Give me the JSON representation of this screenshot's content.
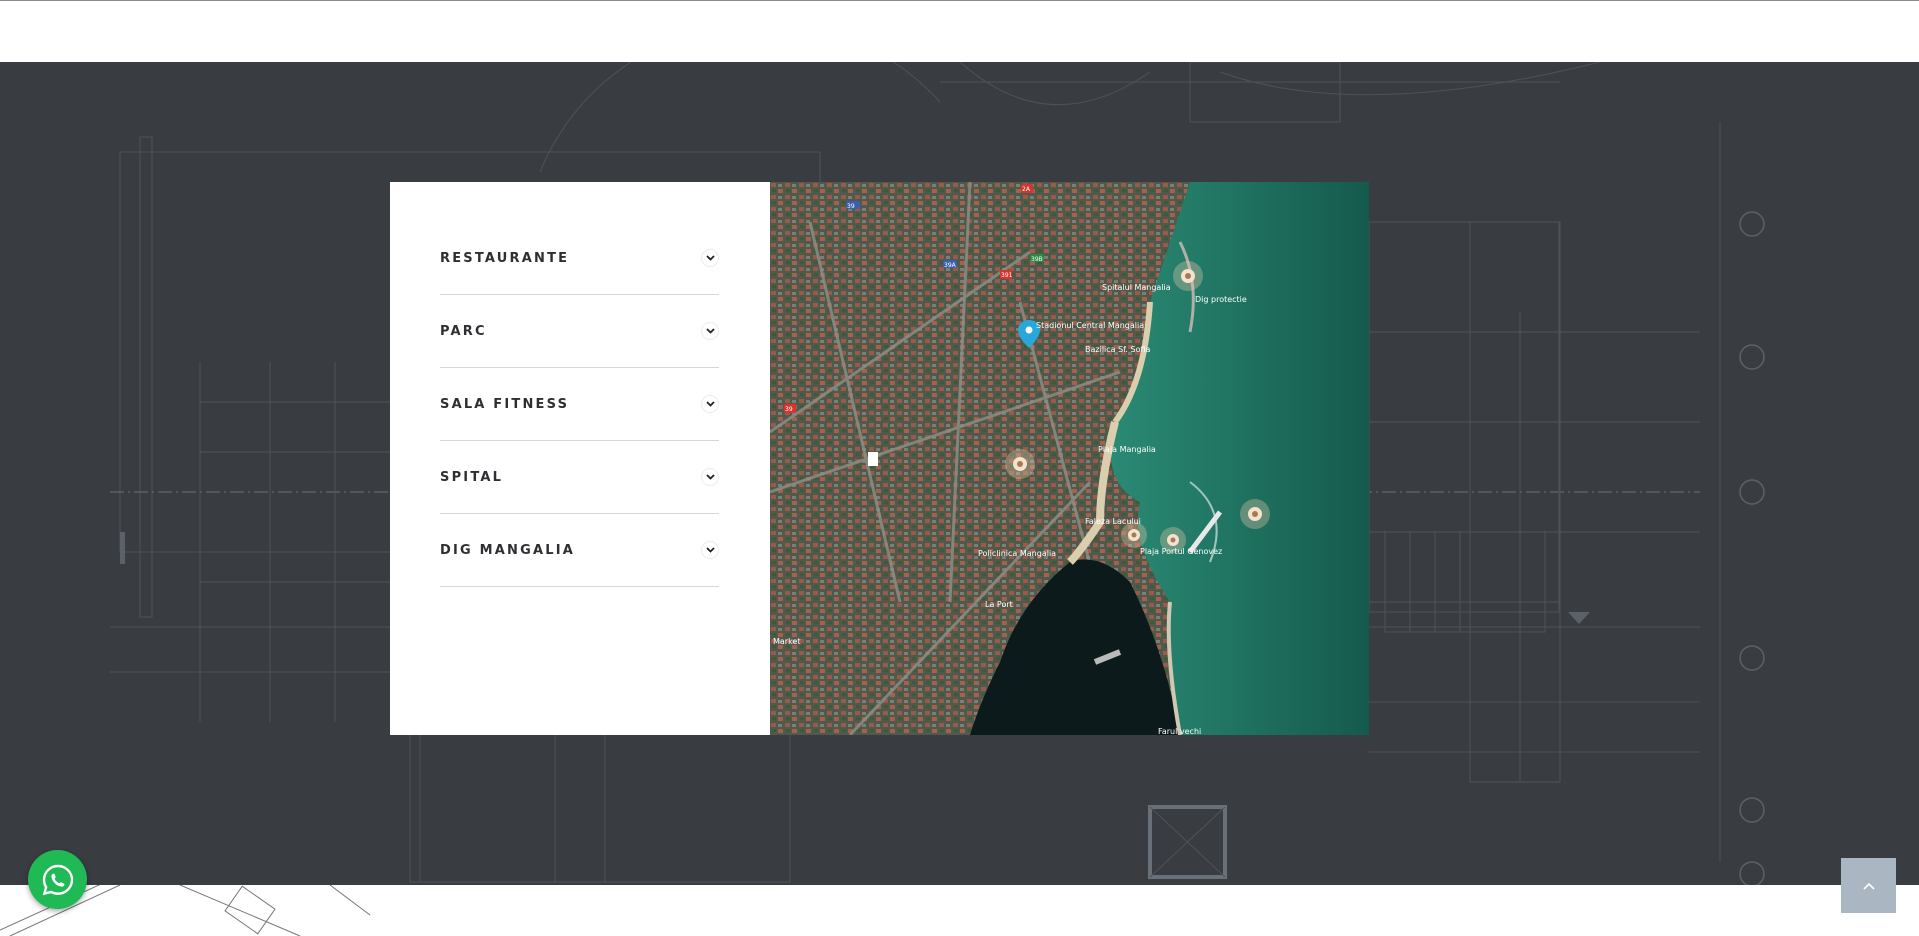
{
  "accordion": {
    "items": [
      {
        "label": "RESTAURANTE"
      },
      {
        "label": "PARC"
      },
      {
        "label": "SALA FITNESS"
      },
      {
        "label": "SPITAL"
      },
      {
        "label": "DIG MANGALIA"
      }
    ]
  },
  "map": {
    "labels": {
      "spital": "Spitalul Mangalia",
      "dig": "Dig protectie",
      "stadion": "Stadionul Central Mangalia",
      "bazilica": "Bazilica Sf. Sofia",
      "plaja": "Plaja Mangalia",
      "faleza": "Faleza Lacului",
      "portul": "Plaja Portul Genovez",
      "policlinica": "Policlinica Mangalia",
      "port": "La Port",
      "market": "Market",
      "farul": "Farul vechi"
    },
    "road_badges": [
      "2A",
      "39",
      "39A",
      "39B",
      "391",
      "39"
    ]
  },
  "colors": {
    "section_bg": "#393d42",
    "whatsapp": "#1fb955",
    "back_to_top": "#aab6c1",
    "sea": "#1d6e5f"
  },
  "icons": {
    "whatsapp": "whatsapp-icon",
    "back_to_top": "chevron-up-icon",
    "accordion": "chevron-down-icon",
    "map_marker": "map-pin-icon"
  }
}
